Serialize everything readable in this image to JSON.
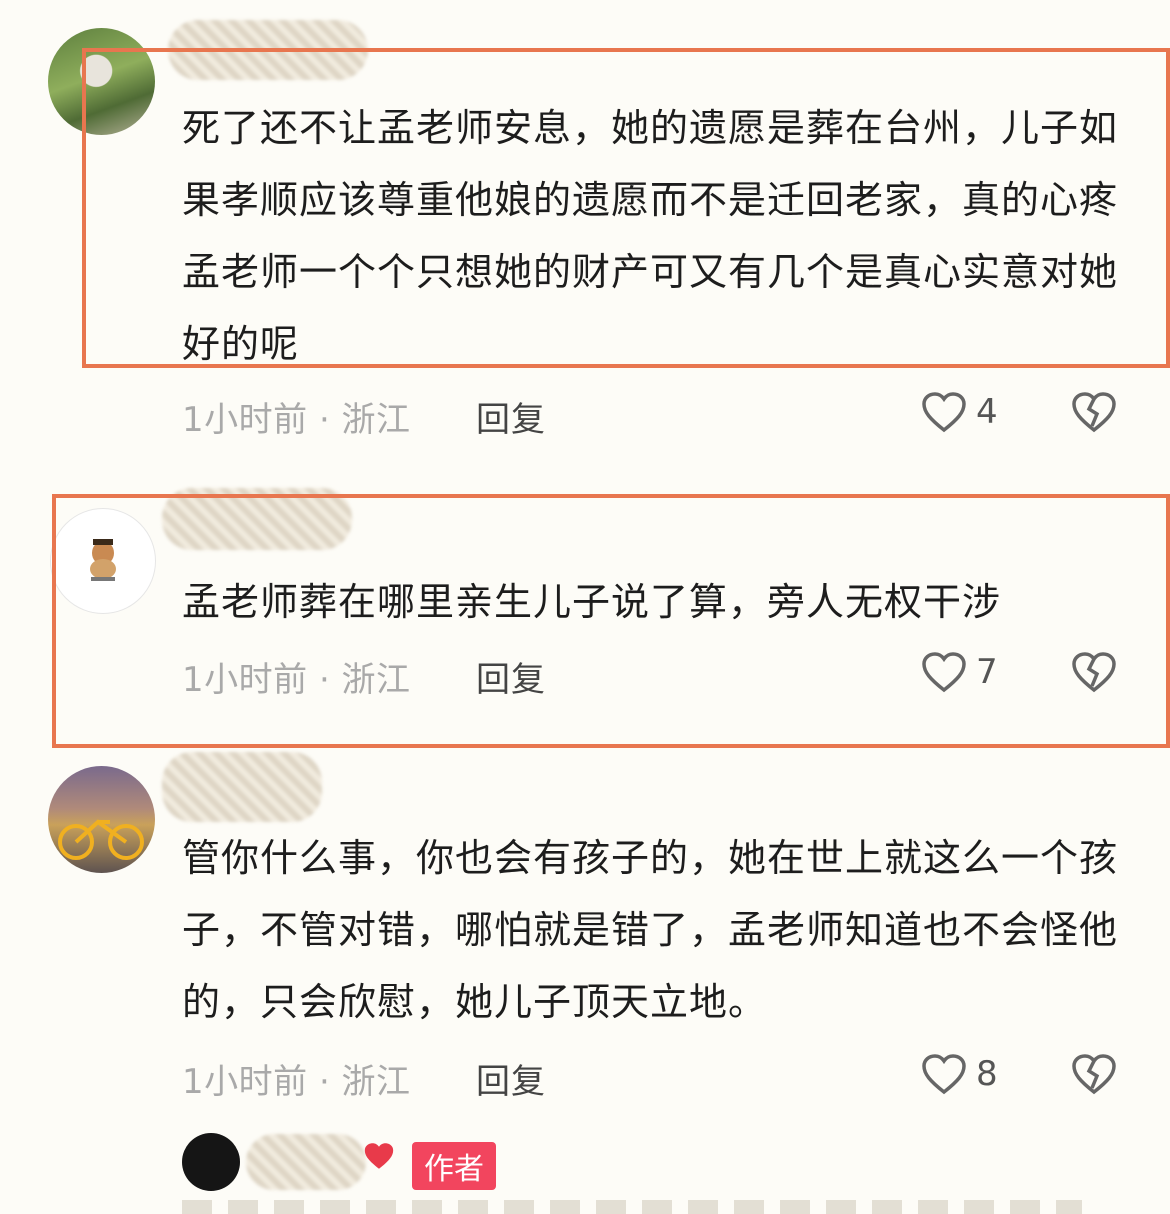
{
  "comments": [
    {
      "text": "死了还不让孟老师安息，她的遗愿是葬在台州，儿子如果孝顺应该尊重他娘的遗愿而不是迁回老家，真的心疼孟老师一个个只想她的财产可又有几个是真心实意对她好的呢",
      "meta": "1小时前 · 浙江",
      "reply": "回复",
      "likes": "4"
    },
    {
      "text": "孟老师葬在哪里亲生儿子说了算，旁人无权干涉",
      "meta": "1小时前 · 浙江",
      "reply": "回复",
      "likes": "7"
    },
    {
      "text": "管你什么事，你也会有孩子的，她在世上就这么一个孩子，不管对错，哪怕就是错了，孟老师知道也不会怪他的，只会欣慰，她儿子顶天立地。",
      "meta": "1小时前 · 浙江",
      "reply": "回复",
      "likes": "8"
    }
  ],
  "author_badge": "作者",
  "colors": {
    "highlight_frame": "#e8764f",
    "author_badge": "#f2455e",
    "meta_text": "#a9a9a9"
  },
  "icons": [
    "heart-outline-icon",
    "broken-heart-icon",
    "heart-emoji-icon"
  ]
}
